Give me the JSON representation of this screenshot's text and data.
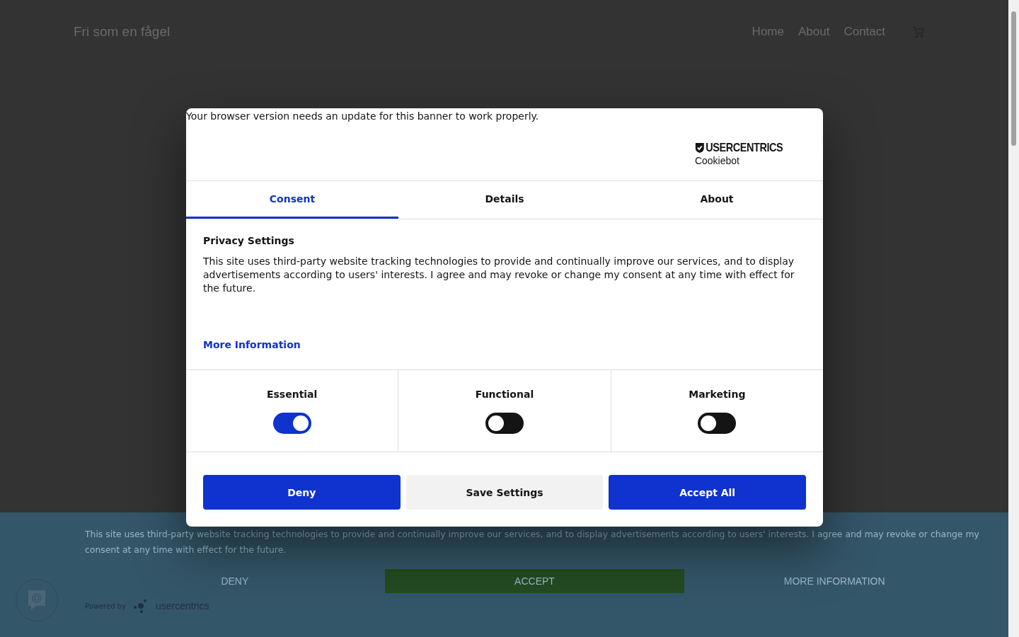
{
  "header": {
    "site_title": "Fri som en fågel",
    "nav": [
      {
        "label": "Home"
      },
      {
        "label": "About"
      },
      {
        "label": "Contact"
      }
    ]
  },
  "dialog": {
    "notice": "Your browser version needs an update for this banner to work properly.",
    "logo": {
      "brand": "USERCENTRICS",
      "product": "Cookiebot"
    },
    "tabs": [
      {
        "label": "Consent",
        "selected": true
      },
      {
        "label": "Details",
        "selected": false
      },
      {
        "label": "About",
        "selected": false
      }
    ],
    "heading": "Privacy Settings",
    "body": "This site uses third-party website tracking technologies to provide and continually improve our services, and to display advertisements according to users' interests. I agree and may revoke or change my consent at any time with effect for the future.",
    "more_link": "More Information",
    "categories": [
      {
        "label": "Essential",
        "on": true
      },
      {
        "label": "Functional",
        "on": false
      },
      {
        "label": "Marketing",
        "on": false
      }
    ],
    "buttons": [
      {
        "label": "Deny",
        "kind": "primary"
      },
      {
        "label": "Save Settings",
        "kind": "secondary"
      },
      {
        "label": "Accept All",
        "kind": "primary"
      }
    ]
  },
  "banner": {
    "text": "This site uses third-party website tracking technologies to provide and continually improve our services, and to display advertisements according to users' interests. I agree and may revoke or change my consent at any time with effect for the future.",
    "buttons": [
      {
        "label": "DENY",
        "kind": "plain"
      },
      {
        "label": "ACCEPT",
        "kind": "filled"
      },
      {
        "label": "MORE INFORMATION",
        "kind": "plain"
      }
    ],
    "powered_by": "Powered by",
    "powered_brand": "usercentrics"
  }
}
